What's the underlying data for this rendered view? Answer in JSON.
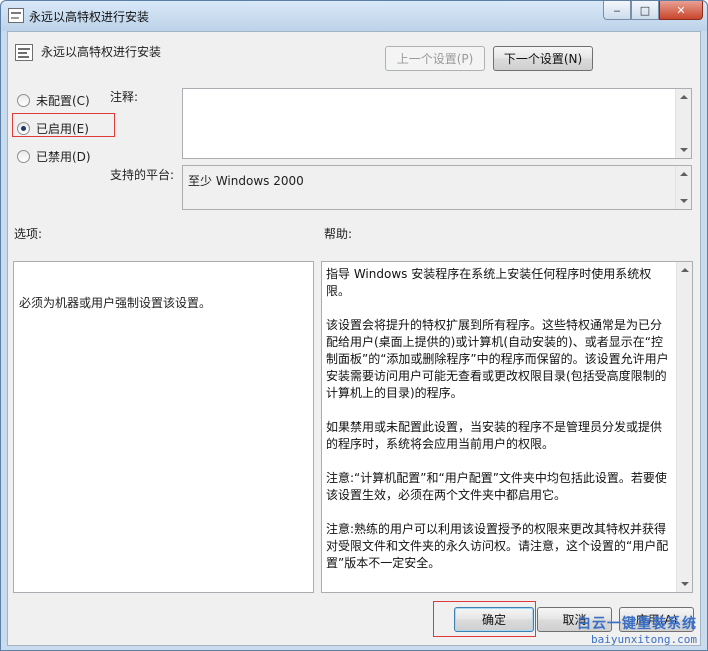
{
  "window": {
    "title": "永远以高特权进行安装"
  },
  "header": {
    "setting_name": "永远以高特权进行安装",
    "prev_button": "上一个设置(P)",
    "next_button": "下一个设置(N)"
  },
  "state": {
    "options": [
      {
        "label": "未配置(C)",
        "checked": false
      },
      {
        "label": "已启用(E)",
        "checked": true
      },
      {
        "label": "已禁用(D)",
        "checked": false
      }
    ]
  },
  "comment": {
    "label": "注释:",
    "value": ""
  },
  "platform": {
    "label": "支持的平台:",
    "value": "至少 Windows 2000"
  },
  "options_panel": {
    "label": "选项:",
    "text": "必须为机器或用户强制设置该设置。"
  },
  "help_panel": {
    "label": "帮助:",
    "paragraphs": [
      "指导 Windows 安装程序在系统上安装任何程序时使用系统权限。",
      "该设置会将提升的特权扩展到所有程序。这些特权通常是为已分配给用户(桌面上提供的)或计算机(自动安装的)、或者显示在“控制面板”的“添加或删除程序”中的程序而保留的。该设置允许用户安装需要访问用户可能无查看或更改权限目录(包括受高度限制的计算机上的目录)的程序。",
      "如果禁用或未配置此设置，当安装的程序不是管理员分发或提供的程序时，系统将会应用当前用户的权限。",
      "注意:“计算机配置”和“用户配置”文件夹中均包括此设置。若要使该设置生效，必须在两个文件夹中都启用它。",
      "注意:熟练的用户可以利用该设置授予的权限来更改其特权并获得对受限文件和文件夹的永久访问权。请注意，这个设置的“用户配置”版本不一定安全。"
    ]
  },
  "footer": {
    "ok_button": "确定",
    "cancel_button": "取消",
    "apply_button": "应用(A)"
  },
  "watermark": {
    "line1": "白云一键重装系统",
    "line2": "baiyunxitong.com"
  },
  "colors": {
    "highlight_box": "#e03a3a",
    "title_bar": "#c9dcef",
    "client_bg": "#f0f0f0"
  }
}
